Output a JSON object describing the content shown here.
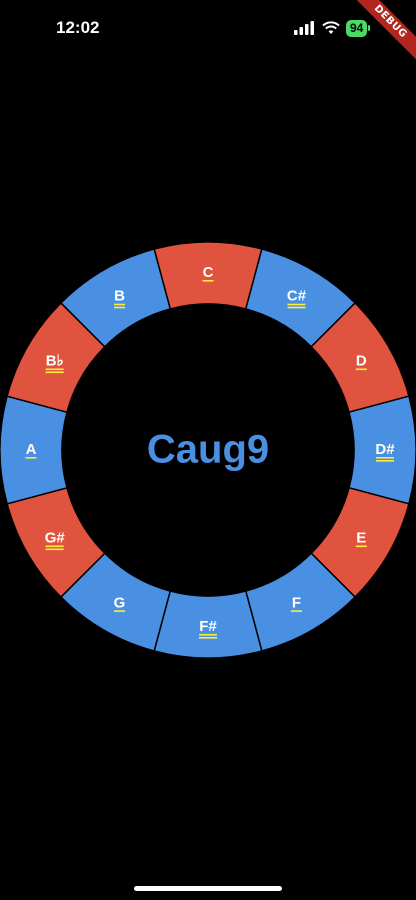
{
  "status_bar": {
    "time": "12:02",
    "battery": "94",
    "debug_label": "DEBUG"
  },
  "wheel": {
    "chord": "Caug9",
    "chord_color": "#4a90e2",
    "segments": [
      {
        "note": "C",
        "color": "#e0533f",
        "underlines": [
          "#ffeb3b"
        ]
      },
      {
        "note": "C#",
        "color": "#4a90e2",
        "underlines": [
          "#ffeb3b",
          "#ffeb3b"
        ]
      },
      {
        "note": "D",
        "color": "#e0533f",
        "underlines": [
          "#ffeb3b"
        ]
      },
      {
        "note": "D#",
        "color": "#4a90e2",
        "underlines": [
          "#ffeb3b",
          "#ffeb3b"
        ]
      },
      {
        "note": "E",
        "color": "#e0533f",
        "underlines": [
          "#ffeb3b"
        ]
      },
      {
        "note": "F",
        "color": "#4a90e2",
        "underlines": [
          "#ffeb3b"
        ]
      },
      {
        "note": "F#",
        "color": "#4a90e2",
        "underlines": [
          "#ffeb3b",
          "#ffeb3b"
        ]
      },
      {
        "note": "G",
        "color": "#4a90e2",
        "underlines": [
          "#ffeb3b"
        ]
      },
      {
        "note": "G#",
        "color": "#e0533f",
        "underlines": [
          "#ffeb3b",
          "#ffeb3b"
        ]
      },
      {
        "note": "A",
        "color": "#4a90e2",
        "underlines": [
          "#ffeb3b"
        ]
      },
      {
        "note": "B♭",
        "color": "#e0533f",
        "underlines": [
          "#ffeb3b",
          "#ffeb3b"
        ]
      },
      {
        "note": "B",
        "color": "#4a90e2",
        "underlines": [
          "#ffeb3b",
          "#ffeb3b"
        ]
      }
    ]
  }
}
